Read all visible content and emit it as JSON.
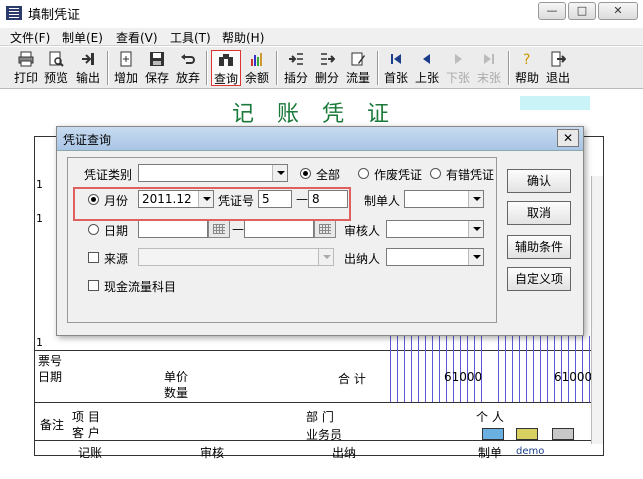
{
  "window": {
    "title": "填制凭证"
  },
  "menu": [
    "文件(F)",
    "制单(E)",
    "查看(V)",
    "工具(T)",
    "帮助(H)"
  ],
  "toolbar": {
    "print": "打印",
    "preview": "预览",
    "export": "输出",
    "add": "增加",
    "save": "保存",
    "discard": "放弃",
    "query": "查询",
    "balance": "余额",
    "insert_row": "插分",
    "delete_row": "删分",
    "flow": "流量",
    "first": "首张",
    "prev": "上张",
    "next": "下张",
    "last": "末张",
    "help": "帮助",
    "exit": "退出"
  },
  "doc": {
    "title": "记 账 凭 证",
    "row1": "1",
    "row2": "1",
    "row3": "1",
    "ticket_no": "票号",
    "date": "日期",
    "unit_price": "单价",
    "quantity": "数量",
    "total": "合 计",
    "total_debit": "61000",
    "total_credit": "61000",
    "remark": "备注",
    "project": "项   目",
    "customer": "客   户",
    "department": "部   门",
    "salesperson": "业务员",
    "person": "个   人",
    "bookkeep": "记账",
    "review": "审核",
    "cashier": "出纳",
    "maker": "制单",
    "maker_name": "demo"
  },
  "dialog": {
    "title": "凭证查询",
    "voucher_type_label": "凭证类别",
    "voucher_type_value": "",
    "all": "全部",
    "void": "作废凭证",
    "error": "有错凭证",
    "month_label": "月份",
    "month_value": "2011.12",
    "voucher_no_label": "凭证号",
    "voucher_no_from": "5",
    "voucher_no_sep": "—",
    "voucher_no_to": "8",
    "maker_label": "制单人",
    "maker_value": "",
    "date_label": "日期",
    "date_from": "",
    "date_sep": "—",
    "date_to": "",
    "reviewer_label": "审核人",
    "reviewer_value": "",
    "source_label": "来源",
    "source_value": "",
    "cashier_label": "出纳人",
    "cashier_value": "",
    "cashflow_label": "现金流量科目",
    "btn_ok": "确认",
    "btn_cancel": "取消",
    "btn_aux": "辅助条件",
    "btn_custom": "自定义项"
  }
}
